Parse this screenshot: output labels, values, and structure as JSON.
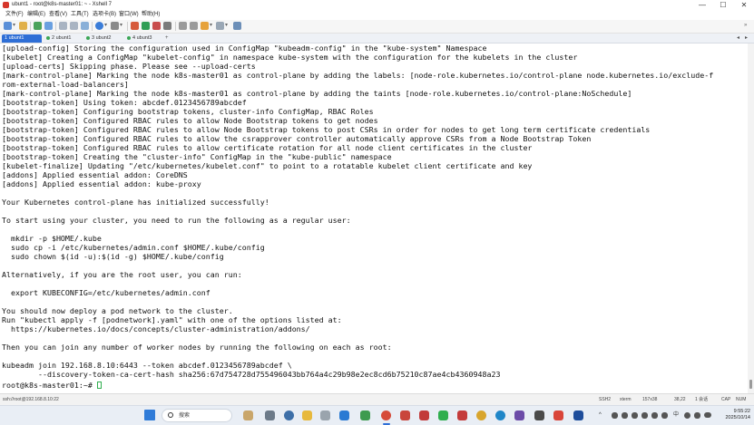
{
  "window": {
    "title": "ubunt1 - root@k8s-master01: ~ - Xshell 7",
    "controls": {
      "minimize": "—",
      "maximize": "☐",
      "close": "✕"
    }
  },
  "menu": [
    "文件(F)",
    "编辑(E)",
    "查看(V)",
    "工具(T)",
    "选项卡(B)",
    "窗口(W)",
    "帮助(H)"
  ],
  "tabs": [
    {
      "label": "1 ubunt1",
      "active": true
    },
    {
      "label": "2 ubunt1",
      "active": false
    },
    {
      "label": "3 ubunt2",
      "active": false
    },
    {
      "label": "4 ubunt3",
      "active": false
    }
  ],
  "terminal": {
    "lines": [
      "[upload-config] Storing the configuration used in ConfigMap \"kubeadm-config\" in the \"kube-system\" Namespace",
      "[kubelet] Creating a ConfigMap \"kubelet-config\" in namespace kube-system with the configuration for the kubelets in the cluster",
      "[upload-certs] Skipping phase. Please see --upload-certs",
      "[mark-control-plane] Marking the node k8s-master01 as control-plane by adding the labels: [node-role.kubernetes.io/control-plane node.kubernetes.io/exclude-f",
      "rom-external-load-balancers]",
      "[mark-control-plane] Marking the node k8s-master01 as control-plane by adding the taints [node-role.kubernetes.io/control-plane:NoSchedule]",
      "[bootstrap-token] Using token: abcdef.0123456789abcdef",
      "[bootstrap-token] Configuring bootstrap tokens, cluster-info ConfigMap, RBAC Roles",
      "[bootstrap-token] Configured RBAC rules to allow Node Bootstrap tokens to get nodes",
      "[bootstrap-token] Configured RBAC rules to allow Node Bootstrap tokens to post CSRs in order for nodes to get long term certificate credentials",
      "[bootstrap-token] Configured RBAC rules to allow the csrapprover controller automatically approve CSRs from a Node Bootstrap Token",
      "[bootstrap-token] Configured RBAC rules to allow certificate rotation for all node client certificates in the cluster",
      "[bootstrap-token] Creating the \"cluster-info\" ConfigMap in the \"kube-public\" namespace",
      "[kubelet-finalize] Updating \"/etc/kubernetes/kubelet.conf\" to point to a rotatable kubelet client certificate and key",
      "[addons] Applied essential addon: CoreDNS",
      "[addons] Applied essential addon: kube-proxy",
      "",
      "Your Kubernetes control-plane has initialized successfully!",
      "",
      "To start using your cluster, you need to run the following as a regular user:",
      "",
      "  mkdir -p $HOME/.kube",
      "  sudo cp -i /etc/kubernetes/admin.conf $HOME/.kube/config",
      "  sudo chown $(id -u):$(id -g) $HOME/.kube/config",
      "",
      "Alternatively, if you are the root user, you can run:",
      "",
      "  export KUBECONFIG=/etc/kubernetes/admin.conf",
      "",
      "You should now deploy a pod network to the cluster.",
      "Run \"kubectl apply -f [podnetwork].yaml\" with one of the options listed at:",
      "  https://kubernetes.io/docs/concepts/cluster-administration/addons/",
      "",
      "Then you can join any number of worker nodes by running the following on each as root:",
      "",
      "kubeadm join 192.168.8.10:6443 --token abcdef.0123456789abcdef \\",
      "        --discovery-token-ca-cert-hash sha256:67d754728d755496043bb764a4c29b98e2ec8cd6b75210c87ae4cb4360948a23"
    ],
    "prompt": "root@k8s-master01:~# "
  },
  "status": {
    "connection": "ssh://root@192.168.8.10:22",
    "protocol": "SSH2",
    "term": "xterm",
    "size": "157x38",
    "cursor_pos": "38,22",
    "sessions": "1 会话",
    "caps": "CAP",
    "num": "NUM"
  },
  "taskbar": {
    "search_label": "搜索",
    "tray_chevron": "^",
    "lang": "中",
    "time": "9:55:22",
    "date": "2025/10/14"
  },
  "colors": {
    "accent": "#2f6fd6",
    "cursor": "#2fae4e",
    "terminal_bg": "#ffffff",
    "terminal_fg": "#111111"
  }
}
